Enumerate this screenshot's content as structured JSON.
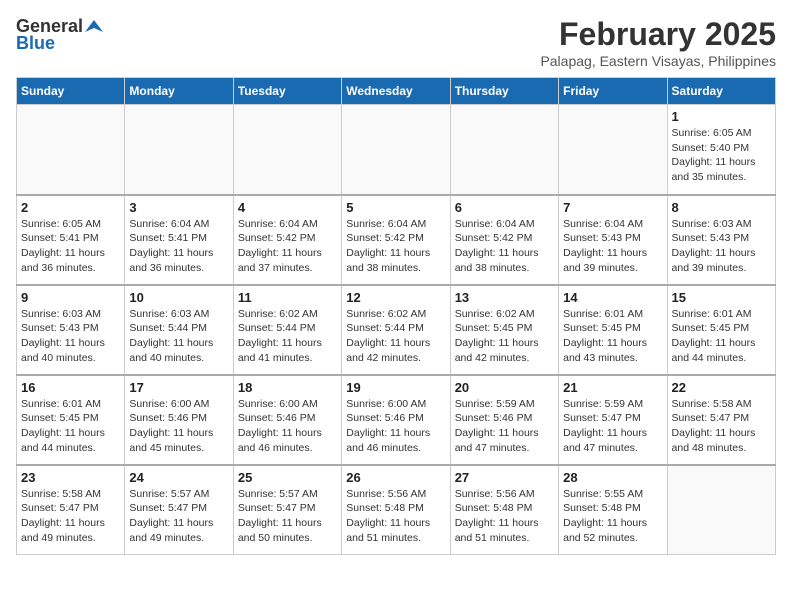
{
  "logo": {
    "general": "General",
    "blue": "Blue"
  },
  "title": {
    "month_year": "February 2025",
    "location": "Palapag, Eastern Visayas, Philippines"
  },
  "headers": [
    "Sunday",
    "Monday",
    "Tuesday",
    "Wednesday",
    "Thursday",
    "Friday",
    "Saturday"
  ],
  "weeks": [
    {
      "days": [
        {
          "num": "",
          "info": ""
        },
        {
          "num": "",
          "info": ""
        },
        {
          "num": "",
          "info": ""
        },
        {
          "num": "",
          "info": ""
        },
        {
          "num": "",
          "info": ""
        },
        {
          "num": "",
          "info": ""
        },
        {
          "num": "1",
          "info": "Sunrise: 6:05 AM\nSunset: 5:40 PM\nDaylight: 11 hours and 35 minutes."
        }
      ]
    },
    {
      "days": [
        {
          "num": "2",
          "info": "Sunrise: 6:05 AM\nSunset: 5:41 PM\nDaylight: 11 hours and 36 minutes."
        },
        {
          "num": "3",
          "info": "Sunrise: 6:04 AM\nSunset: 5:41 PM\nDaylight: 11 hours and 36 minutes."
        },
        {
          "num": "4",
          "info": "Sunrise: 6:04 AM\nSunset: 5:42 PM\nDaylight: 11 hours and 37 minutes."
        },
        {
          "num": "5",
          "info": "Sunrise: 6:04 AM\nSunset: 5:42 PM\nDaylight: 11 hours and 38 minutes."
        },
        {
          "num": "6",
          "info": "Sunrise: 6:04 AM\nSunset: 5:42 PM\nDaylight: 11 hours and 38 minutes."
        },
        {
          "num": "7",
          "info": "Sunrise: 6:04 AM\nSunset: 5:43 PM\nDaylight: 11 hours and 39 minutes."
        },
        {
          "num": "8",
          "info": "Sunrise: 6:03 AM\nSunset: 5:43 PM\nDaylight: 11 hours and 39 minutes."
        }
      ]
    },
    {
      "days": [
        {
          "num": "9",
          "info": "Sunrise: 6:03 AM\nSunset: 5:43 PM\nDaylight: 11 hours and 40 minutes."
        },
        {
          "num": "10",
          "info": "Sunrise: 6:03 AM\nSunset: 5:44 PM\nDaylight: 11 hours and 40 minutes."
        },
        {
          "num": "11",
          "info": "Sunrise: 6:02 AM\nSunset: 5:44 PM\nDaylight: 11 hours and 41 minutes."
        },
        {
          "num": "12",
          "info": "Sunrise: 6:02 AM\nSunset: 5:44 PM\nDaylight: 11 hours and 42 minutes."
        },
        {
          "num": "13",
          "info": "Sunrise: 6:02 AM\nSunset: 5:45 PM\nDaylight: 11 hours and 42 minutes."
        },
        {
          "num": "14",
          "info": "Sunrise: 6:01 AM\nSunset: 5:45 PM\nDaylight: 11 hours and 43 minutes."
        },
        {
          "num": "15",
          "info": "Sunrise: 6:01 AM\nSunset: 5:45 PM\nDaylight: 11 hours and 44 minutes."
        }
      ]
    },
    {
      "days": [
        {
          "num": "16",
          "info": "Sunrise: 6:01 AM\nSunset: 5:45 PM\nDaylight: 11 hours and 44 minutes."
        },
        {
          "num": "17",
          "info": "Sunrise: 6:00 AM\nSunset: 5:46 PM\nDaylight: 11 hours and 45 minutes."
        },
        {
          "num": "18",
          "info": "Sunrise: 6:00 AM\nSunset: 5:46 PM\nDaylight: 11 hours and 46 minutes."
        },
        {
          "num": "19",
          "info": "Sunrise: 6:00 AM\nSunset: 5:46 PM\nDaylight: 11 hours and 46 minutes."
        },
        {
          "num": "20",
          "info": "Sunrise: 5:59 AM\nSunset: 5:46 PM\nDaylight: 11 hours and 47 minutes."
        },
        {
          "num": "21",
          "info": "Sunrise: 5:59 AM\nSunset: 5:47 PM\nDaylight: 11 hours and 47 minutes."
        },
        {
          "num": "22",
          "info": "Sunrise: 5:58 AM\nSunset: 5:47 PM\nDaylight: 11 hours and 48 minutes."
        }
      ]
    },
    {
      "days": [
        {
          "num": "23",
          "info": "Sunrise: 5:58 AM\nSunset: 5:47 PM\nDaylight: 11 hours and 49 minutes."
        },
        {
          "num": "24",
          "info": "Sunrise: 5:57 AM\nSunset: 5:47 PM\nDaylight: 11 hours and 49 minutes."
        },
        {
          "num": "25",
          "info": "Sunrise: 5:57 AM\nSunset: 5:47 PM\nDaylight: 11 hours and 50 minutes."
        },
        {
          "num": "26",
          "info": "Sunrise: 5:56 AM\nSunset: 5:48 PM\nDaylight: 11 hours and 51 minutes."
        },
        {
          "num": "27",
          "info": "Sunrise: 5:56 AM\nSunset: 5:48 PM\nDaylight: 11 hours and 51 minutes."
        },
        {
          "num": "28",
          "info": "Sunrise: 5:55 AM\nSunset: 5:48 PM\nDaylight: 11 hours and 52 minutes."
        },
        {
          "num": "",
          "info": ""
        }
      ]
    }
  ]
}
